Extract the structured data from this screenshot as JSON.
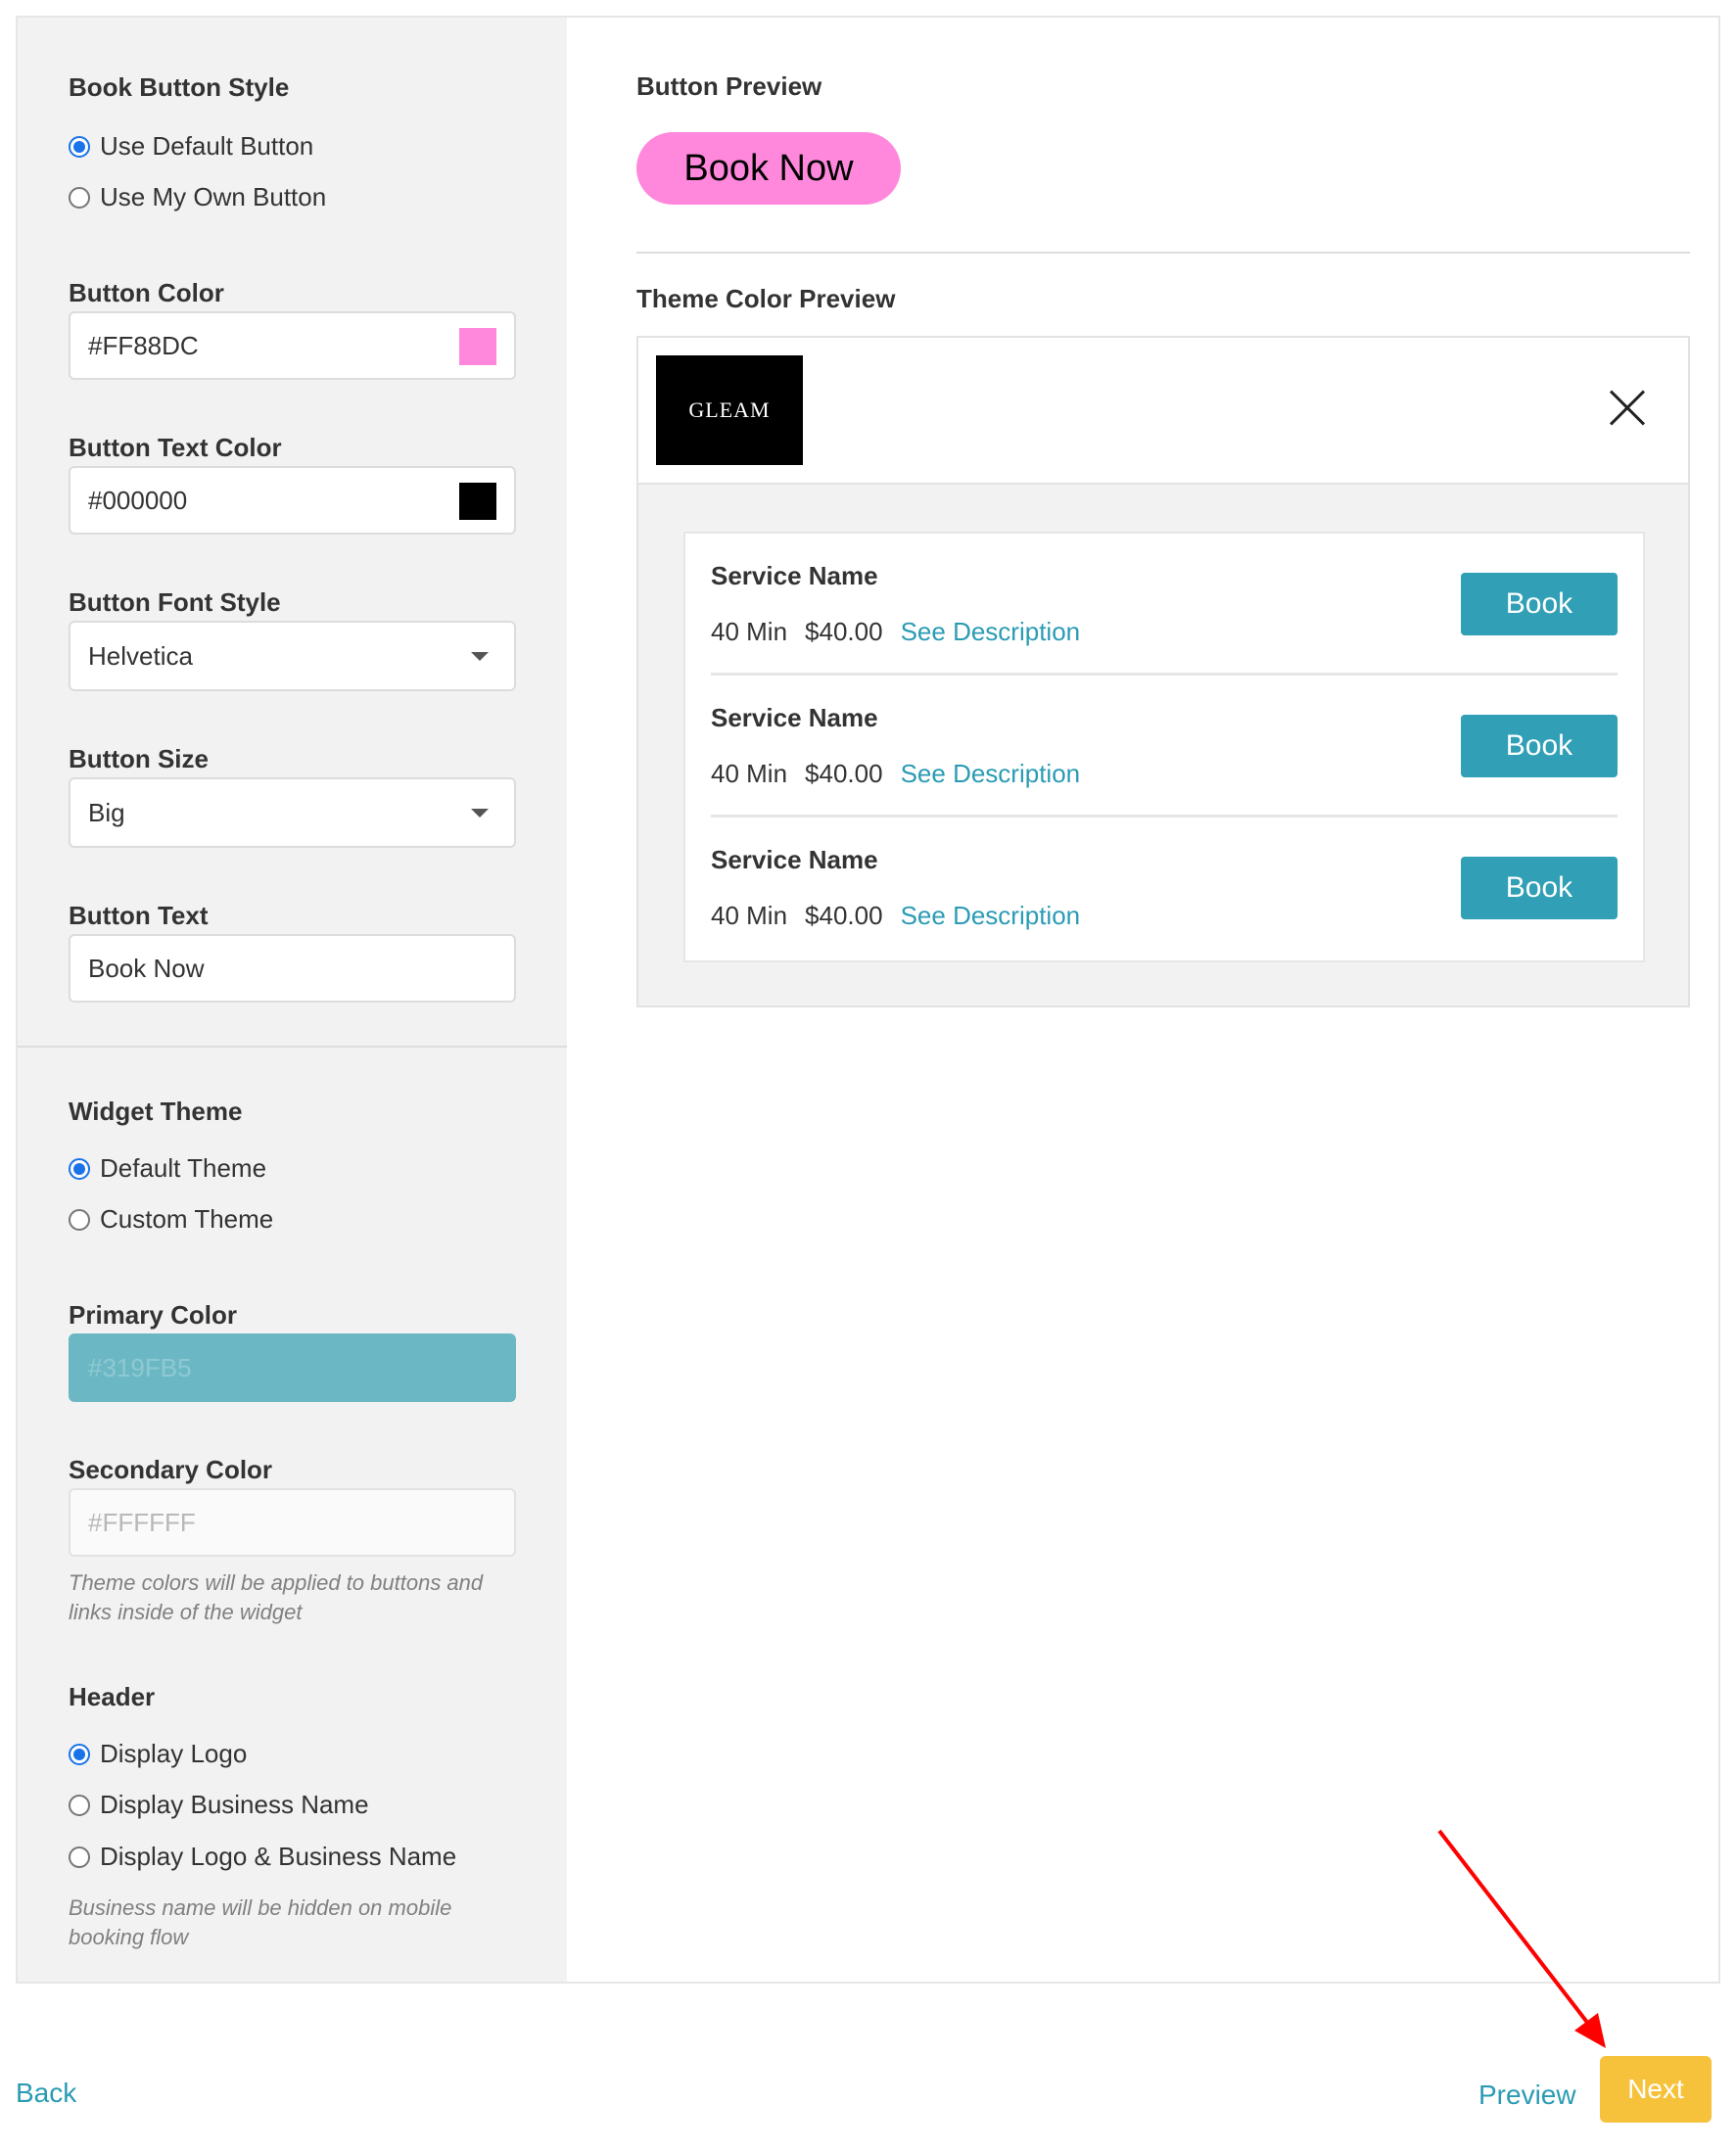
{
  "colors": {
    "button_preview_bg": "#FF88DC",
    "button_preview_text": "#000000",
    "primary": "#319FB5",
    "primary_field_bg": "#6BB8C4",
    "next_button": "#F7C23B",
    "link": "#2A9BB4",
    "annotation_arrow": "#FF0000"
  },
  "book_button_style": {
    "title": "Book Button Style",
    "options": [
      {
        "label": "Use Default Button",
        "checked": true
      },
      {
        "label": "Use My Own Button",
        "checked": false
      }
    ]
  },
  "button_color": {
    "label": "Button Color",
    "value": "#FF88DC"
  },
  "button_text_color": {
    "label": "Button Text Color",
    "value": "#000000"
  },
  "button_font_style": {
    "label": "Button Font Style",
    "value": "Helvetica"
  },
  "button_size": {
    "label": "Button Size",
    "value": "Big"
  },
  "button_text": {
    "label": "Button Text",
    "value": "Book Now"
  },
  "widget_theme": {
    "title": "Widget Theme",
    "options": [
      {
        "label": "Default Theme",
        "checked": true
      },
      {
        "label": "Custom Theme",
        "checked": false
      }
    ]
  },
  "primary_color": {
    "label": "Primary Color",
    "value": "#319FB5"
  },
  "secondary_color": {
    "label": "Secondary Color",
    "value": "#FFFFFF"
  },
  "theme_hint": "Theme colors will be applied to buttons and links inside of the widget",
  "header": {
    "title": "Header",
    "options": [
      {
        "label": "Display Logo",
        "checked": true
      },
      {
        "label": "Display Business Name",
        "checked": false
      },
      {
        "label": "Display Logo & Business Name",
        "checked": false
      }
    ],
    "hint": "Business name will be hidden on mobile booking flow"
  },
  "button_preview": {
    "title": "Button Preview",
    "label": "Book Now"
  },
  "theme_preview": {
    "title": "Theme Color Preview",
    "logo_text": "GLEAM",
    "close_icon": "close-icon",
    "services": [
      {
        "name": "Service Name",
        "duration": "40 Min",
        "price": "$40.00",
        "link": "See Description",
        "button": "Book"
      },
      {
        "name": "Service Name",
        "duration": "40 Min",
        "price": "$40.00",
        "link": "See Description",
        "button": "Book"
      },
      {
        "name": "Service Name",
        "duration": "40 Min",
        "price": "$40.00",
        "link": "See Description",
        "button": "Book"
      }
    ]
  },
  "footer": {
    "back": "Back",
    "preview": "Preview",
    "next": "Next"
  }
}
